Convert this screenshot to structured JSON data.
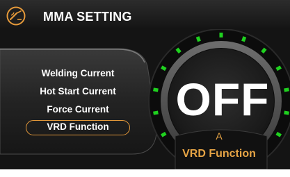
{
  "header": {
    "title": "MMA SETTING",
    "icon": "welding-electrode-icon"
  },
  "menu": {
    "items": [
      {
        "label": "Welding Current",
        "selected": false
      },
      {
        "label": "Hot Start Current",
        "selected": false
      },
      {
        "label": "Force Current",
        "selected": false
      },
      {
        "label": "VRD Function",
        "selected": true
      }
    ]
  },
  "dial": {
    "value": "OFF",
    "unit": "A",
    "label": "VRD Function"
  },
  "colors": {
    "accent": "#e69a3a",
    "tick_active": "#1fd11f",
    "background": "#141414",
    "text": "#ffffff"
  }
}
